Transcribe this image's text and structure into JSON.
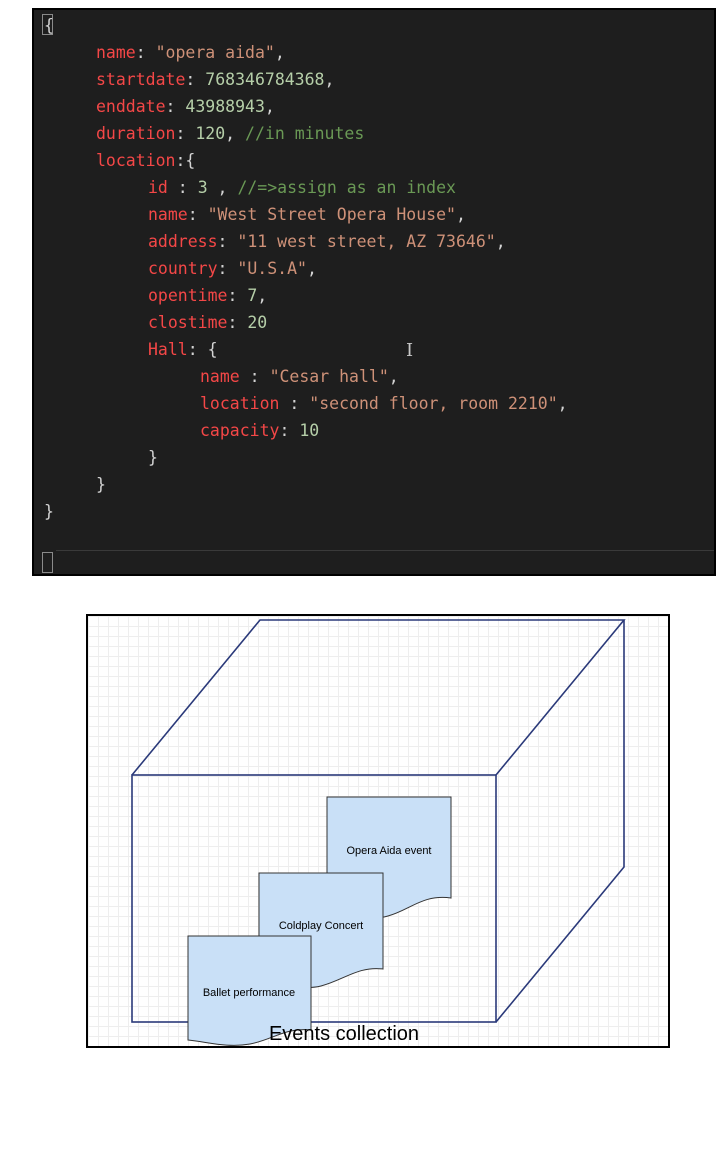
{
  "code": {
    "lines": [
      {
        "indent": 0,
        "tokens": [
          {
            "t": "{",
            "c": "brace"
          }
        ]
      },
      {
        "indent": 1,
        "tokens": [
          {
            "t": "name",
            "c": "key"
          },
          {
            "t": ": ",
            "c": "punc"
          },
          {
            "t": "\"opera aida\"",
            "c": "str"
          },
          {
            "t": ",",
            "c": "punc"
          }
        ]
      },
      {
        "indent": 1,
        "tokens": [
          {
            "t": "startdate",
            "c": "key"
          },
          {
            "t": ": ",
            "c": "punc"
          },
          {
            "t": "768346784368",
            "c": "num"
          },
          {
            "t": ",",
            "c": "punc"
          }
        ]
      },
      {
        "indent": 1,
        "tokens": [
          {
            "t": "enddate",
            "c": "key"
          },
          {
            "t": ": ",
            "c": "punc"
          },
          {
            "t": "43988943",
            "c": "num"
          },
          {
            "t": ",",
            "c": "punc"
          }
        ]
      },
      {
        "indent": 1,
        "tokens": [
          {
            "t": "duration",
            "c": "key"
          },
          {
            "t": ": ",
            "c": "punc"
          },
          {
            "t": "120",
            "c": "num"
          },
          {
            "t": ", ",
            "c": "punc"
          },
          {
            "t": "//in minutes",
            "c": "com"
          }
        ]
      },
      {
        "indent": 1,
        "tokens": [
          {
            "t": "location",
            "c": "key"
          },
          {
            "t": ":{",
            "c": "punc"
          }
        ]
      },
      {
        "indent": 2,
        "tokens": [
          {
            "t": "id",
            "c": "key"
          },
          {
            "t": " : ",
            "c": "punc"
          },
          {
            "t": "3",
            "c": "num"
          },
          {
            "t": " , ",
            "c": "punc"
          },
          {
            "t": "//=>assign as an index",
            "c": "com"
          }
        ]
      },
      {
        "indent": 2,
        "tokens": [
          {
            "t": "name",
            "c": "key"
          },
          {
            "t": ": ",
            "c": "punc"
          },
          {
            "t": "\"West Street Opera House\"",
            "c": "str"
          },
          {
            "t": ",",
            "c": "punc"
          }
        ]
      },
      {
        "indent": 2,
        "tokens": [
          {
            "t": "address",
            "c": "key"
          },
          {
            "t": ": ",
            "c": "punc"
          },
          {
            "t": "\"11 west street, AZ 73646\"",
            "c": "str"
          },
          {
            "t": ",",
            "c": "punc"
          }
        ]
      },
      {
        "indent": 2,
        "tokens": [
          {
            "t": "country",
            "c": "key"
          },
          {
            "t": ": ",
            "c": "punc"
          },
          {
            "t": "\"U.S.A\"",
            "c": "str"
          },
          {
            "t": ",",
            "c": "punc"
          }
        ]
      },
      {
        "indent": 2,
        "tokens": [
          {
            "t": "opentime",
            "c": "key"
          },
          {
            "t": ": ",
            "c": "punc"
          },
          {
            "t": "7",
            "c": "num"
          },
          {
            "t": ",",
            "c": "punc"
          }
        ]
      },
      {
        "indent": 2,
        "tokens": [
          {
            "t": "clostime",
            "c": "key"
          },
          {
            "t": ": ",
            "c": "punc"
          },
          {
            "t": "20",
            "c": "num"
          }
        ]
      },
      {
        "indent": 2,
        "tokens": [
          {
            "t": "Hall",
            "c": "key"
          },
          {
            "t": ": {",
            "c": "punc"
          }
        ]
      },
      {
        "indent": 3,
        "tokens": [
          {
            "t": "name",
            "c": "key"
          },
          {
            "t": " : ",
            "c": "punc"
          },
          {
            "t": "\"Cesar hall\"",
            "c": "str"
          },
          {
            "t": ",",
            "c": "punc"
          }
        ]
      },
      {
        "indent": 3,
        "tokens": [
          {
            "t": "location",
            "c": "key"
          },
          {
            "t": " : ",
            "c": "punc"
          },
          {
            "t": "\"second floor, room 2210\"",
            "c": "str"
          },
          {
            "t": ",",
            "c": "punc"
          }
        ]
      },
      {
        "indent": 3,
        "tokens": [
          {
            "t": "capacity",
            "c": "key"
          },
          {
            "t": ": ",
            "c": "punc"
          },
          {
            "t": "10",
            "c": "num"
          }
        ]
      },
      {
        "indent": 2,
        "tokens": [
          {
            "t": "}",
            "c": "punc"
          }
        ]
      },
      {
        "indent": 1,
        "tokens": [
          {
            "t": "}",
            "c": "punc"
          }
        ]
      },
      {
        "indent": 0,
        "tokens": [
          {
            "t": "}",
            "c": "brace"
          }
        ]
      }
    ],
    "cursor_glyph": "I"
  },
  "diagram": {
    "documents": [
      {
        "label": "Opera Aida event"
      },
      {
        "label": "Coldplay Concert"
      },
      {
        "label": "Ballet performance"
      }
    ],
    "caption": "Events collection",
    "colors": {
      "cube_stroke": "#2b3a7a",
      "doc_fill": "#c9e0f7",
      "doc_stroke": "#333333"
    }
  }
}
